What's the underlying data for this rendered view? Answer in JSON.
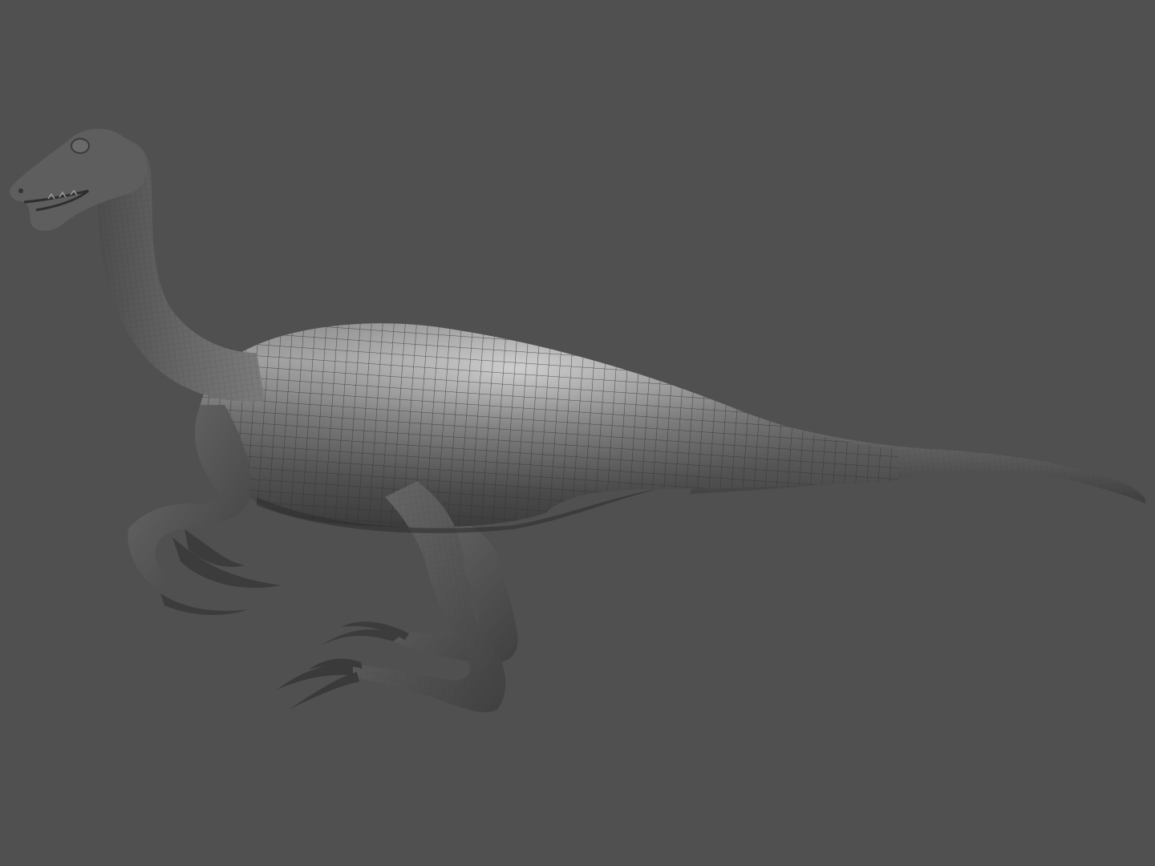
{
  "viewport": {
    "background_color": "#505050"
  },
  "model": {
    "subject": "theropod-dinosaur",
    "shading": "grey-clay-with-wireframe",
    "base_color": "#5c5c5c",
    "shadow_color": "#3a3a3a",
    "highlight_color": "#cfcfcf",
    "wire_color": "#2e2e2e"
  }
}
